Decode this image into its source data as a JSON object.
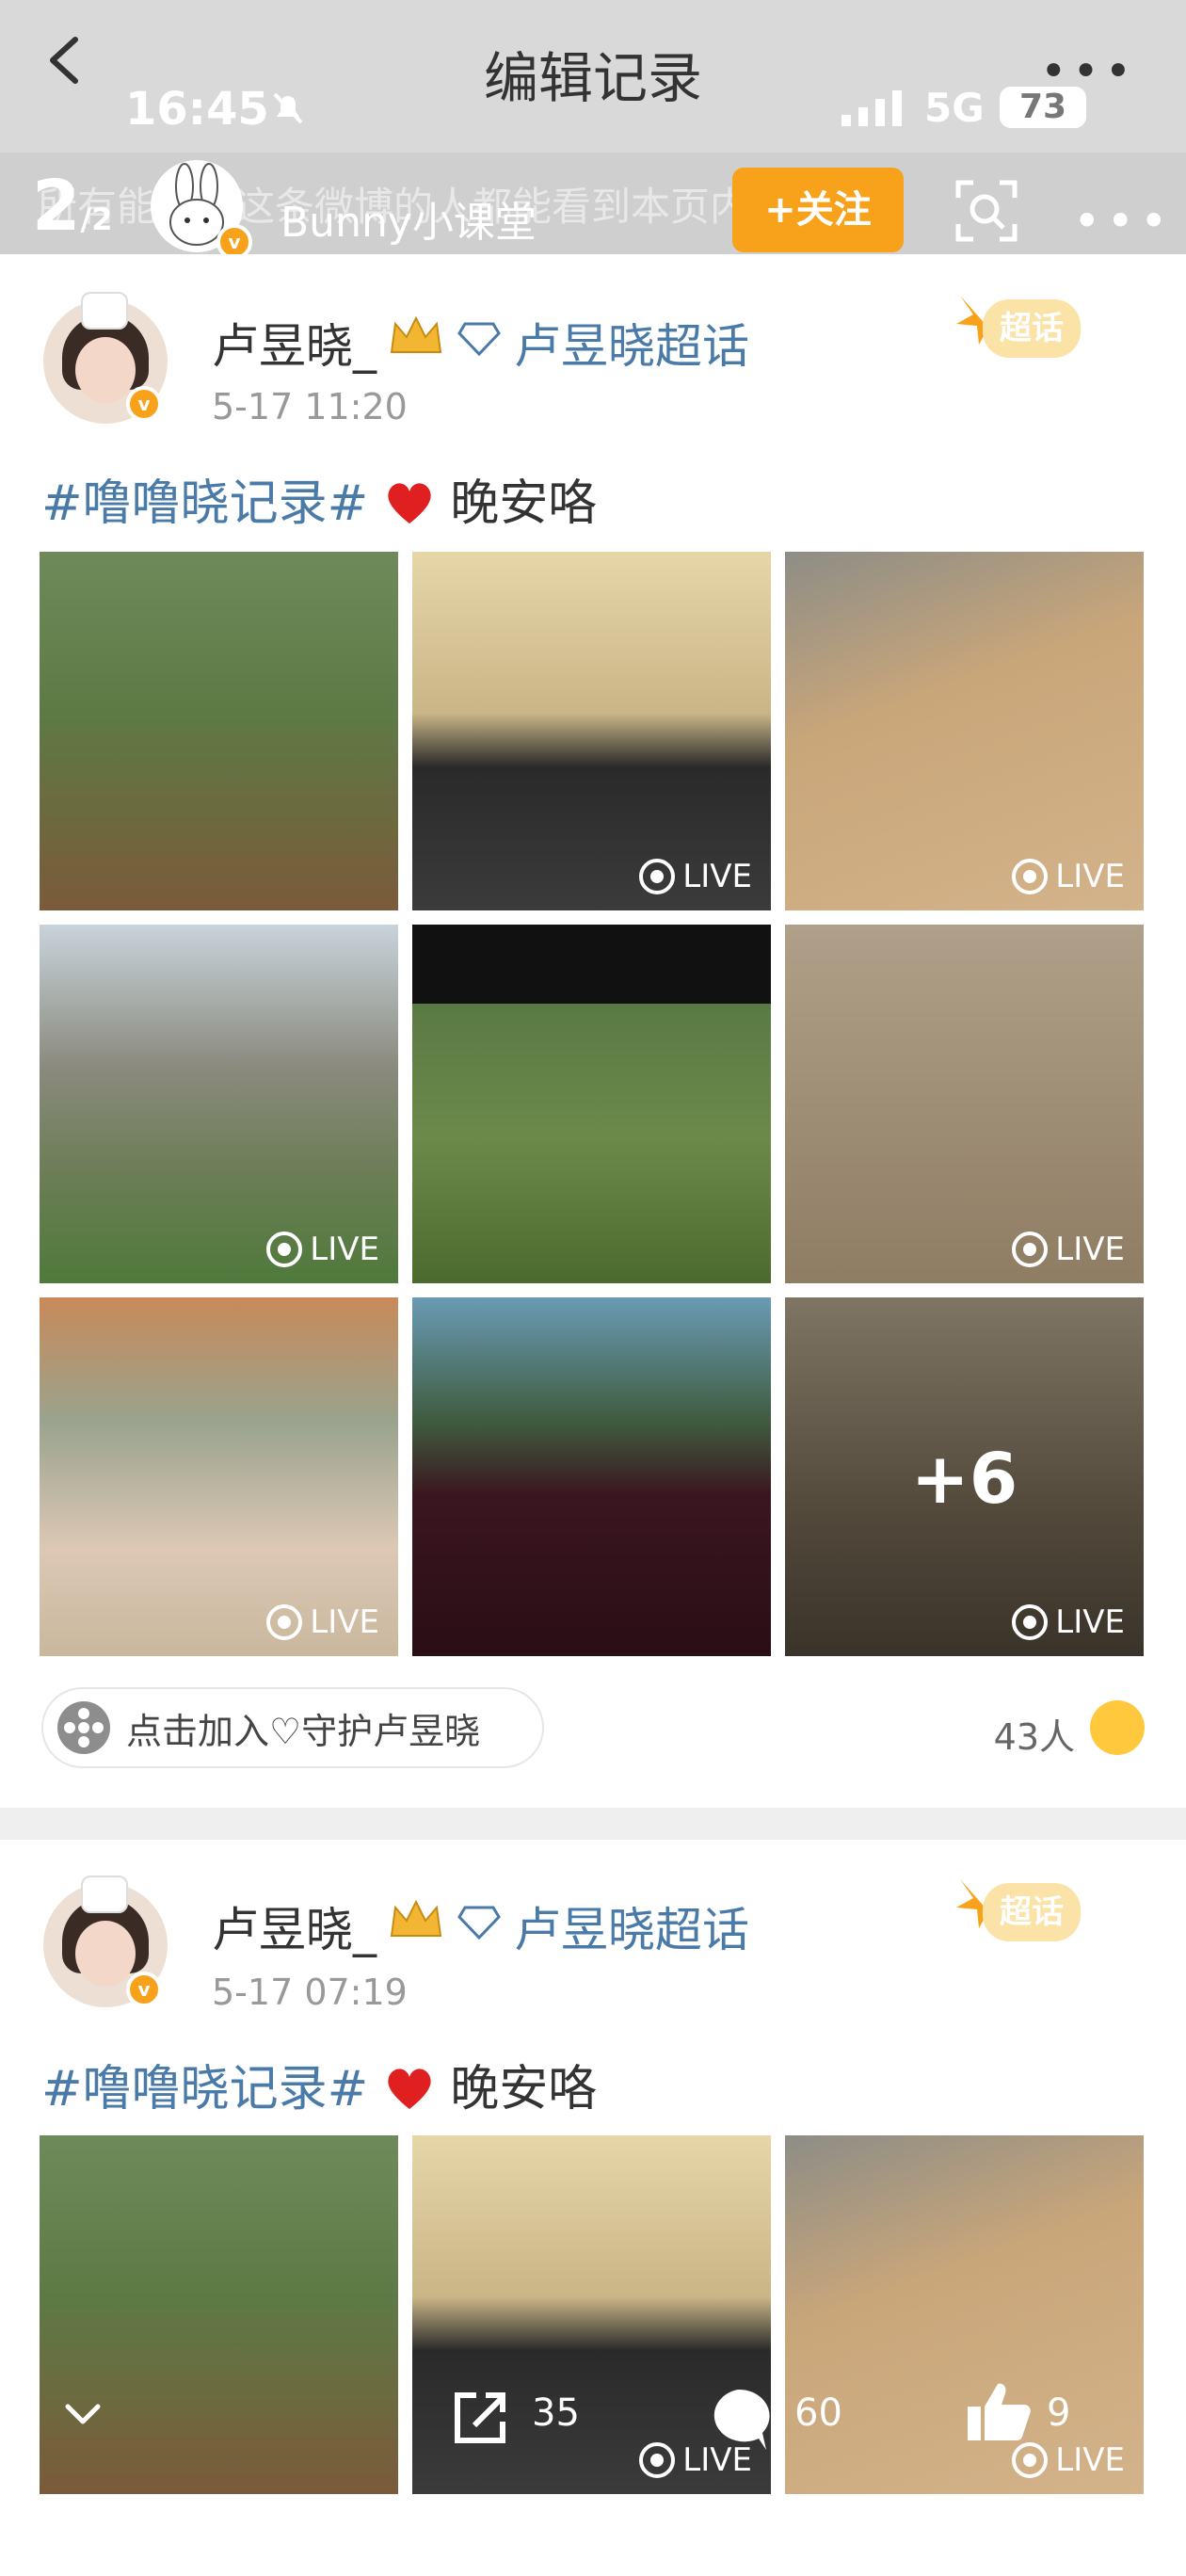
{
  "header": {
    "title": "编辑记录",
    "status_time": "16:45",
    "network": "5G",
    "battery": "73",
    "page_indicator_main": "2",
    "page_indicator_sub": "/2",
    "notice": "所有能看到这条微博的人都能看到本页内",
    "username": "Bunny小课堂",
    "follow_label": "+关注"
  },
  "posts": [
    {
      "author": "卢昱晓_",
      "topic": "卢昱晓超话",
      "time": "5-17 11:20",
      "tag": "#噜噜晓记录#",
      "text": "晚安咯",
      "live_label": "LIVE",
      "more_count": "+6",
      "fan_label": "点击加入♡守护卢昱晓",
      "fan_count": "43人"
    },
    {
      "author": "卢昱晓_",
      "topic": "卢昱晓超话",
      "time": "5-17 07:19",
      "tag": "#噜噜晓记录#",
      "text": "晚安咯",
      "live_label": "LIVE"
    }
  ],
  "toolbar": {
    "share_count": "35",
    "comment_count": "60",
    "like_count": "9"
  },
  "colors": {
    "accent_orange": "#f7a21a",
    "topic_blue": "#4a7aa8"
  }
}
